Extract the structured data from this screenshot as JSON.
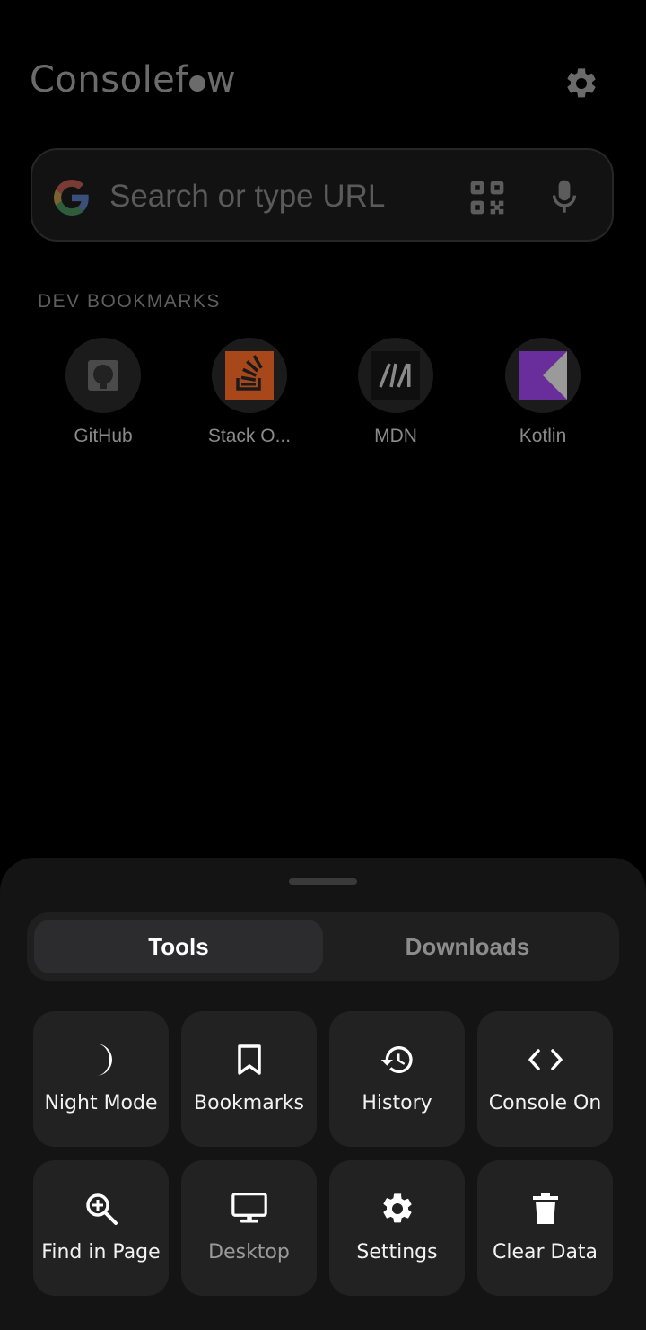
{
  "app": {
    "logo_text_left": "Consolef",
    "logo_text_right": "w"
  },
  "search": {
    "placeholder": "Search or type URL",
    "value": ""
  },
  "bookmarks": {
    "section_label": "DEV BOOKMARKS",
    "items": [
      {
        "label": "GitHub",
        "icon": "github-icon"
      },
      {
        "label": "Stack O...",
        "icon": "stackoverflow-icon"
      },
      {
        "label": "MDN",
        "icon": "mdn-icon"
      },
      {
        "label": "Kotlin",
        "icon": "kotlin-icon"
      }
    ]
  },
  "sheet": {
    "tabs": [
      {
        "label": "Tools",
        "active": true
      },
      {
        "label": "Downloads",
        "active": false
      }
    ],
    "tools": [
      {
        "label": "Night Mode",
        "icon": "moon-icon"
      },
      {
        "label": "Bookmarks",
        "icon": "bookmark-icon"
      },
      {
        "label": "History",
        "icon": "history-icon"
      },
      {
        "label": "Console On",
        "icon": "code-icon"
      },
      {
        "label": "Find in Page",
        "icon": "zoom-in-icon"
      },
      {
        "label": "Desktop",
        "icon": "monitor-icon"
      },
      {
        "label": "Settings",
        "icon": "gear-icon"
      },
      {
        "label": "Clear Data",
        "icon": "trash-icon"
      }
    ]
  },
  "colors": {
    "background": "#000000",
    "sheet": "#141414",
    "tile": "#222222",
    "accent_text": "#f2f2f2"
  }
}
